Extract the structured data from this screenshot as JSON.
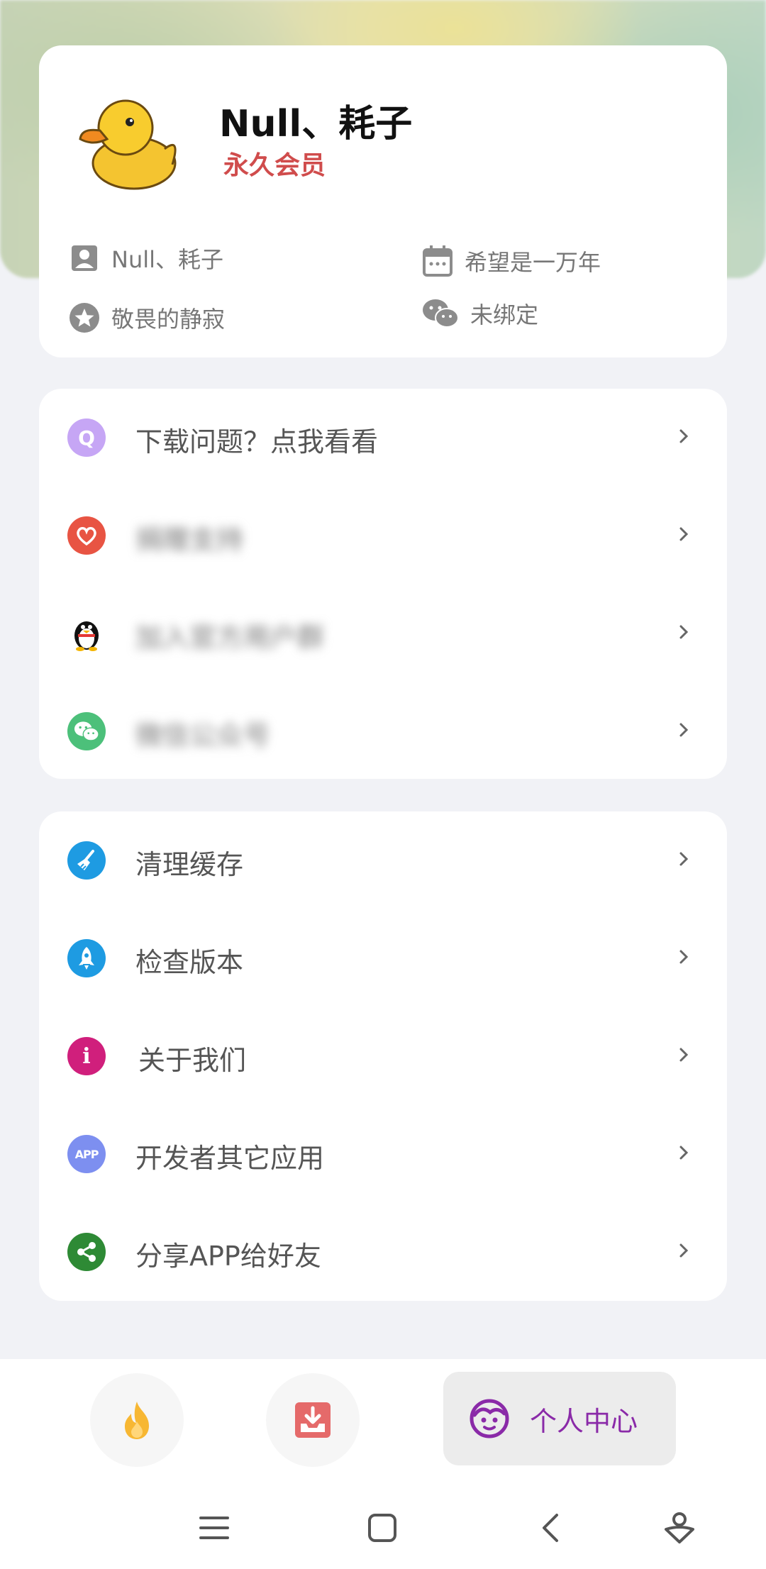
{
  "profile": {
    "username": "Null、耗子",
    "membership": "永久会员",
    "info": {
      "account": "Null、耗子",
      "expiry": "希望是一万年",
      "level": "敬畏的静寂",
      "wechat": "未绑定"
    }
  },
  "menu_support": [
    {
      "label": "下载问题？点我看看",
      "icon": "q-icon",
      "color": "#c6a6f5",
      "blurred": false
    },
    {
      "label": "捐赠支持",
      "icon": "heart-icon",
      "color": "#e85443",
      "blurred": true
    },
    {
      "label": "加入官方用户群",
      "icon": "qq-penguin-icon",
      "color": "#ffffff",
      "blurred": true
    },
    {
      "label": "微信公众号",
      "icon": "wechat-icon",
      "color": "#4cc07a",
      "blurred": true
    }
  ],
  "menu_settings": [
    {
      "label": "清理缓存",
      "icon": "broom-icon",
      "color": "#1e9be2"
    },
    {
      "label": "检查版本",
      "icon": "rocket-icon",
      "color": "#1e9be2"
    },
    {
      "label": "关于我们",
      "icon": "info-icon",
      "color": "#d01f7c"
    },
    {
      "label": "开发者其它应用",
      "icon": "app-icon",
      "color": "#7d8ff0"
    },
    {
      "label": "分享APP给好友",
      "icon": "share-icon",
      "color": "#2e8a35"
    }
  ],
  "bottom_nav": {
    "hot_icon": "flame-icon",
    "download_icon": "download-tray-icon",
    "profile_label": "个人中心",
    "profile_icon": "face-icon",
    "accent": "#8a2aa8"
  },
  "system_nav": [
    "menu-icon",
    "home-square-icon",
    "back-icon",
    "assistant-icon"
  ]
}
